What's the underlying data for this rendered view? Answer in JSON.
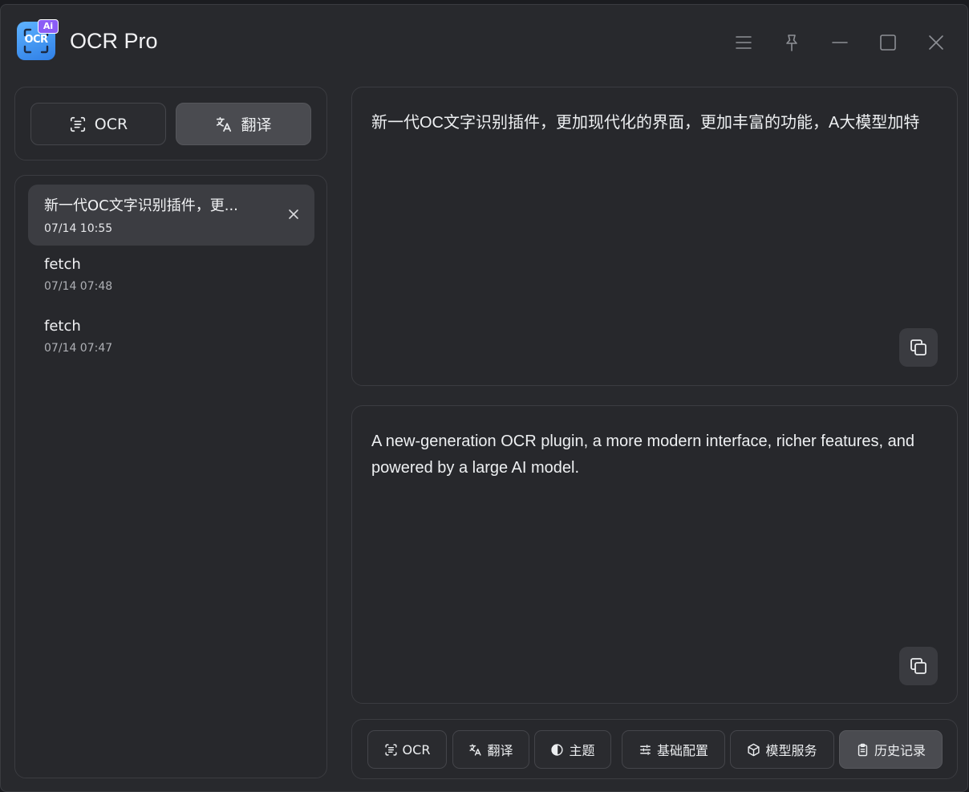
{
  "app": {
    "title": "OCR Pro",
    "logo_text": "OCR",
    "logo_badge": "Ai"
  },
  "mode_tabs": [
    {
      "label": "OCR",
      "icon": "scan-text-icon",
      "active": false
    },
    {
      "label": "翻译",
      "icon": "translate-icon",
      "active": true
    }
  ],
  "history": [
    {
      "title": "新一代OC文字识别插件，更...",
      "time": "07/14 10:55",
      "selected": true
    },
    {
      "title": "fetch",
      "time": "07/14 07:48",
      "selected": false
    },
    {
      "title": "fetch",
      "time": "07/14 07:47",
      "selected": false
    }
  ],
  "source_text": "新一代OC文字识别插件，更加现代化的界面，更加丰富的功能，A大模型加特",
  "translated_text": "A new-generation OCR plugin, a more modern interface, richer features, and powered by a large AI model.",
  "toolbar": [
    {
      "label": "OCR",
      "icon": "scan-text-icon"
    },
    {
      "label": "翻译",
      "icon": "translate-icon"
    },
    {
      "label": "主题",
      "icon": "theme-icon"
    },
    {
      "label": "基础配置",
      "icon": "sliders-icon"
    },
    {
      "label": "模型服务",
      "icon": "cube-icon"
    },
    {
      "label": "历史记录",
      "icon": "clipboard-icon",
      "active": true
    }
  ]
}
